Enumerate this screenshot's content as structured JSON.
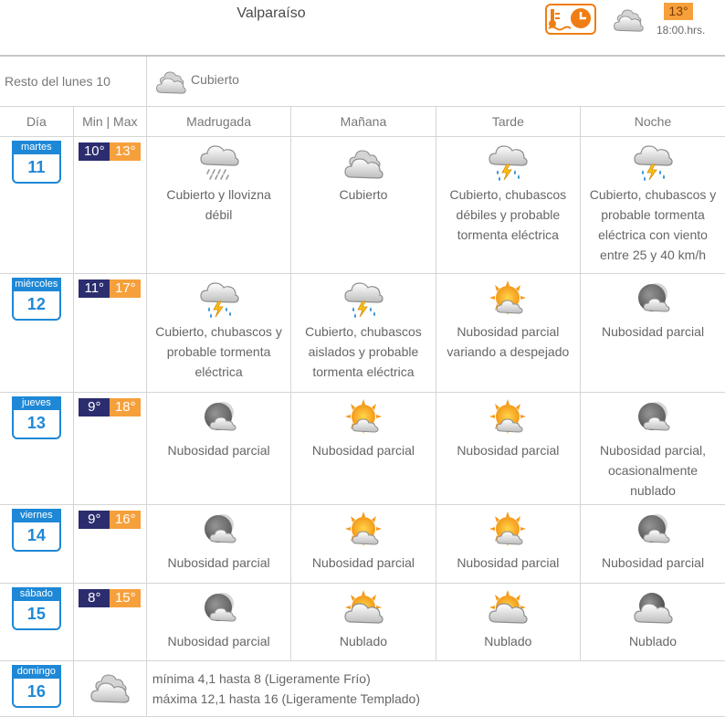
{
  "header": {
    "city": "Valparaíso",
    "current_temp": "13°",
    "current_time": "18:00.hrs."
  },
  "rest_of_day": {
    "label": "Resto del lunes 10",
    "condition": "Cubierto"
  },
  "columns": [
    "Día",
    "Min | Max",
    "Madrugada",
    "Mañana",
    "Tarde",
    "Noche"
  ],
  "days": [
    {
      "day_name": "martes",
      "day_num": "11",
      "min": "10°",
      "max": "13°",
      "periods": [
        {
          "icon": "drizzle-icon",
          "text": "Cubierto y llovizna débil"
        },
        {
          "icon": "cloudy-icon",
          "text": "Cubierto"
        },
        {
          "icon": "thunderstorm-icon",
          "text": "Cubierto, chubascos débiles y probable tormenta eléctrica"
        },
        {
          "icon": "thunderstorm-icon",
          "text": "Cubierto, chubascos y probable tormenta eléctrica con viento entre 25 y 40 km/h"
        }
      ]
    },
    {
      "day_name": "miércoles",
      "day_num": "12",
      "min": "11°",
      "max": "17°",
      "periods": [
        {
          "icon": "thunderstorm-icon",
          "text": "Cubierto, chubascos y probable tormenta eléctrica"
        },
        {
          "icon": "thunderstorm-icon",
          "text": "Cubierto, chubascos aislados y probable tormenta eléctrica"
        },
        {
          "icon": "partly-sunny-icon",
          "text": "Nubosidad parcial variando a despejado"
        },
        {
          "icon": "partly-cloudy-night-icon",
          "text": "Nubosidad parcial"
        }
      ]
    },
    {
      "day_name": "jueves",
      "day_num": "13",
      "min": "9°",
      "max": "18°",
      "periods": [
        {
          "icon": "partly-cloudy-night-icon",
          "text": "Nubosidad parcial"
        },
        {
          "icon": "partly-sunny-icon",
          "text": "Nubosidad parcial"
        },
        {
          "icon": "partly-sunny-icon",
          "text": "Nubosidad parcial"
        },
        {
          "icon": "partly-cloudy-night-icon",
          "text": "Nubosidad parcial, ocasionalmente nublado"
        }
      ]
    },
    {
      "day_name": "viernes",
      "day_num": "14",
      "min": "9°",
      "max": "16°",
      "periods": [
        {
          "icon": "partly-cloudy-night-icon",
          "text": "Nubosidad parcial"
        },
        {
          "icon": "partly-sunny-icon",
          "text": "Nubosidad parcial"
        },
        {
          "icon": "partly-sunny-icon",
          "text": "Nubosidad parcial"
        },
        {
          "icon": "partly-cloudy-night-icon",
          "text": "Nubosidad parcial"
        }
      ]
    },
    {
      "day_name": "sábado",
      "day_num": "15",
      "min": "8°",
      "max": "15°",
      "periods": [
        {
          "icon": "partly-cloudy-night-icon",
          "text": "Nubosidad parcial"
        },
        {
          "icon": "mostly-cloudy-sun-icon",
          "text": "Nublado"
        },
        {
          "icon": "mostly-cloudy-sun-icon",
          "text": "Nublado"
        },
        {
          "icon": "mostly-cloudy-night-icon",
          "text": "Nublado"
        }
      ]
    }
  ],
  "sunday": {
    "day_name": "domingo",
    "day_num": "16",
    "icon": "cloudy-icon",
    "min_text": "mínima 4,1 hasta 8 (Ligeramente Frío)",
    "max_text": "máxima 12,1 hasta 16 (Ligeramente Templado)"
  },
  "colors": {
    "accent_blue": "#1e88d6",
    "min_temp": "#2c2d6e",
    "max_temp": "#f6a03c",
    "brand_orange": "#f07d13"
  }
}
